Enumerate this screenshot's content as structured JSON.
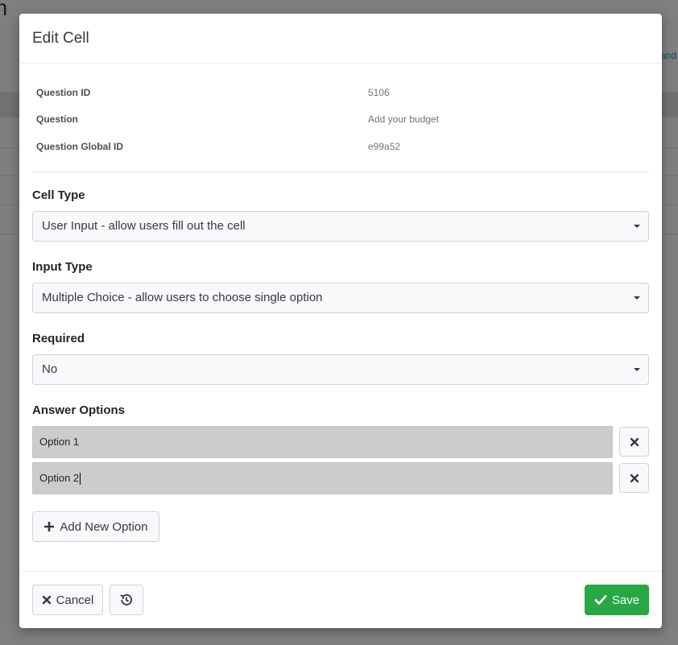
{
  "background": {
    "title_fragment": "m",
    "link_fragment": "and"
  },
  "modal": {
    "title": "Edit Cell",
    "info": [
      {
        "label": "Question ID",
        "value": "5106"
      },
      {
        "label": "Question",
        "value": "Add your budget"
      },
      {
        "label": "Question Global ID",
        "value": "e99a52"
      }
    ],
    "cell_type": {
      "label": "Cell Type",
      "selected": "User Input - allow users fill out the cell"
    },
    "input_type": {
      "label": "Input Type",
      "selected": "Multiple Choice - allow users to choose single option"
    },
    "required": {
      "label": "Required",
      "selected": "No"
    },
    "answer_options": {
      "label": "Answer Options",
      "options": [
        {
          "value": "Option 1"
        },
        {
          "value": "Option 2"
        }
      ],
      "add_label": "Add New Option"
    },
    "footer": {
      "cancel_label": "Cancel",
      "save_label": "Save"
    }
  },
  "colors": {
    "save_green": "#28a745",
    "backdrop": "rgba(0,0,0,0.5)",
    "option_input_bg": "#cccccc"
  },
  "icons": {
    "remove": "close-icon",
    "add": "plus-icon",
    "cancel": "close-icon",
    "history": "history-icon",
    "save": "check-icon"
  }
}
